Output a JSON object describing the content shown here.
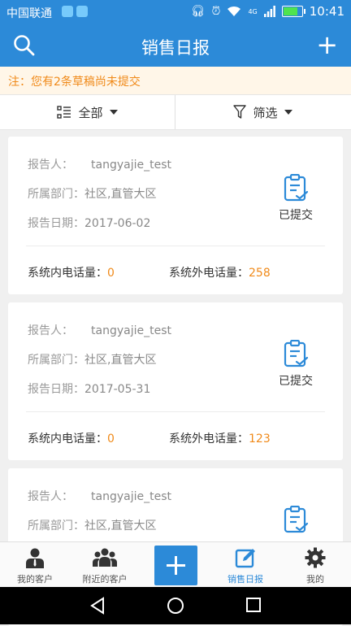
{
  "status_bar": {
    "carrier": "中国联通",
    "network": "4G",
    "time": "10:41"
  },
  "header": {
    "title": "销售日报"
  },
  "notice": {
    "text": "注：您有2条草稿尚未提交"
  },
  "filters": {
    "all_label": "全部",
    "filter_label": "筛选"
  },
  "labels": {
    "reporter": "报告人：",
    "department": "所属部门：",
    "date": "报告日期：",
    "internal_calls": "系统内电话量：",
    "external_calls": "系统外电话量："
  },
  "reports": [
    {
      "reporter": "tangyajie_test",
      "department": "社区,直管大区",
      "date": "2017-06-02",
      "status": "已提交",
      "internal_calls": "0",
      "external_calls": "258"
    },
    {
      "reporter": "tangyajie_test",
      "department": "社区,直管大区",
      "date": "2017-05-31",
      "status": "已提交",
      "internal_calls": "0",
      "external_calls": "123"
    },
    {
      "reporter": "tangyajie_test",
      "department": "社区,直管大区",
      "date": "",
      "status": "",
      "internal_calls": "",
      "external_calls": ""
    }
  ],
  "tabs": [
    {
      "label": "我的客户",
      "icon": "person-icon"
    },
    {
      "label": "附近的客户",
      "icon": "group-icon"
    },
    {
      "label": "",
      "icon": "plus-icon"
    },
    {
      "label": "销售日报",
      "icon": "edit-icon"
    },
    {
      "label": "我的",
      "icon": "gear-icon"
    }
  ],
  "colors": {
    "primary": "#2c8ad8",
    "accent": "#f08a1a"
  }
}
